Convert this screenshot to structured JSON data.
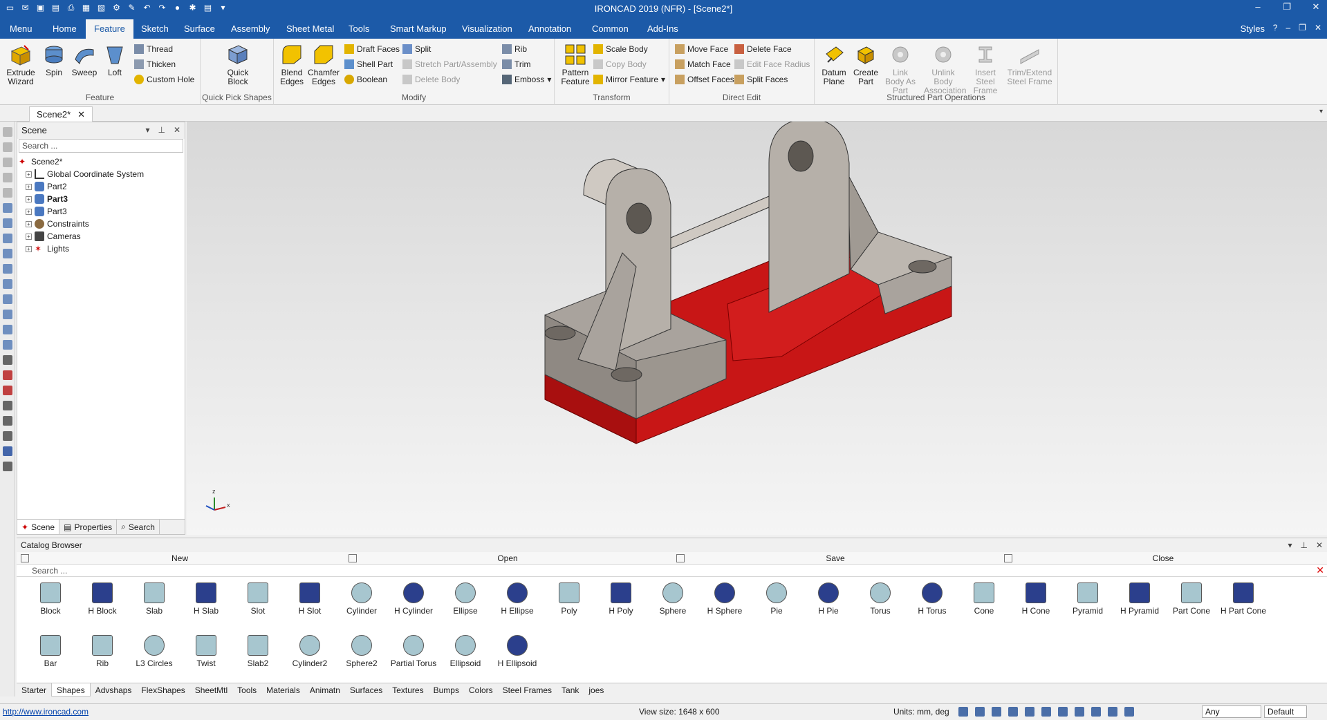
{
  "app": {
    "title": "IRONCAD 2019 (NFR) - [Scene2*]",
    "window_controls": [
      "–",
      "❐",
      "✕"
    ]
  },
  "menu_tabs": [
    "Menu",
    "Home",
    "Feature",
    "Sketch",
    "Surface",
    "Assembly",
    "Sheet Metal",
    "Tools",
    "Smart Markup",
    "Visualization",
    "Annotation",
    "Common",
    "Add-Ins"
  ],
  "menu_active": "Feature",
  "styles_label": "Styles",
  "ribbon": {
    "feature": {
      "label": "Feature",
      "extrude": "Extrude Wizard",
      "spin": "Spin",
      "sweep": "Sweep",
      "loft": "Loft",
      "thread": "Thread",
      "thicken": "Thicken",
      "custom_hole": "Custom Hole"
    },
    "quick_pick": {
      "label": "Quick Pick Shapes",
      "quick_block": "Quick Block"
    },
    "modify": {
      "label": "Modify",
      "blend": "Blend Edges",
      "chamfer": "Chamfer Edges",
      "draft": "Draft Faces",
      "shell": "Shell Part",
      "boolean": "Boolean",
      "split": "Split",
      "stretch": "Stretch Part/Assembly",
      "delete_body": "Delete Body",
      "rib": "Rib",
      "trim": "Trim",
      "emboss": "Emboss"
    },
    "transform": {
      "label": "Transform",
      "pattern": "Pattern Feature",
      "scale": "Scale Body",
      "copy": "Copy Body",
      "mirror": "Mirror Feature"
    },
    "direct_edit": {
      "label": "Direct Edit",
      "move_face": "Move Face",
      "match_face": "Match Face",
      "offset_faces": "Offset Faces",
      "delete_face": "Delete Face",
      "edit_radius": "Edit Face Radius",
      "split_faces": "Split Faces"
    },
    "structured": {
      "label": "Structured Part Operations",
      "datum": "Datum Plane",
      "create_part": "Create Part",
      "link_body": "Link Body As Part",
      "unlink_body": "Unlink Body Association",
      "insert_steel": "Insert Steel Frame",
      "trim_steel": "Trim/Extend Steel Frame"
    }
  },
  "doc_tab": "Scene2*",
  "scene_panel": {
    "title": "Scene",
    "search_placeholder": "Search ...",
    "root": "Scene2*",
    "items": [
      "Global Coordinate System",
      "Part2",
      "Part3",
      "Part3",
      "Constraints",
      "Cameras",
      "Lights"
    ],
    "tabs": [
      "Scene",
      "Properties",
      "Search"
    ]
  },
  "triad": {
    "z": "z",
    "x": "x"
  },
  "catalog": {
    "title": "Catalog Browser",
    "tools": [
      "New",
      "Open",
      "Save",
      "Close"
    ],
    "search_placeholder": "Search ...",
    "shapes_row1": [
      "Block",
      "H Block",
      "Slab",
      "H Slab",
      "Slot",
      "H Slot",
      "Cylinder",
      "H Cylinder",
      "Ellipse",
      "H Ellipse",
      "Poly",
      "H Poly",
      "Sphere",
      "H Sphere",
      "Pie",
      "H Pie",
      "Torus",
      "H Torus",
      "Cone",
      "H Cone",
      "Pyramid",
      "H Pyramid",
      "Part Cone",
      "H Part Cone"
    ],
    "shapes_row2": [
      "Bar",
      "Rib",
      "L3 Circles",
      "Twist",
      "Slab2",
      "Cylinder2",
      "Sphere2",
      "Partial Torus",
      "Ellipsoid",
      "H Ellipsoid"
    ],
    "tabs": [
      "Starter",
      "Shapes",
      "Advshaps",
      "FlexShapes",
      "SheetMtl",
      "Tools",
      "Materials",
      "Animatn",
      "Surfaces",
      "Textures",
      "Bumps",
      "Colors",
      "Steel Frames",
      "Tank",
      "joes"
    ],
    "active_tab": "Shapes"
  },
  "status": {
    "link": "http://www.ironcad.com",
    "view_size": "View size: 1648 x 600",
    "units": "Units: mm, deg",
    "filter": "Any",
    "style": "Default"
  },
  "colors": {
    "accent": "#1c5aa8",
    "part_red": "#cc1a1a",
    "part_gray": "#a8a29c"
  }
}
